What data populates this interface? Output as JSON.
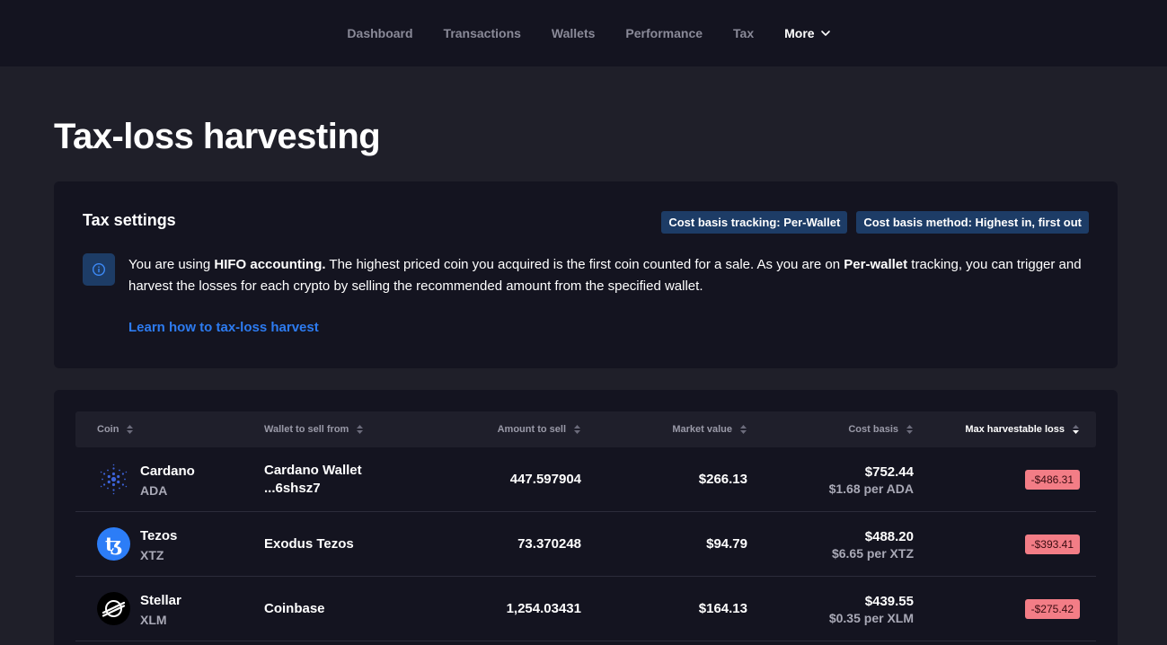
{
  "nav": {
    "items": [
      "Dashboard",
      "Transactions",
      "Wallets",
      "Performance",
      "Tax"
    ],
    "more_label": "More"
  },
  "page_title": "Tax-loss harvesting",
  "settings": {
    "title": "Tax settings",
    "badge_tracking": "Cost basis tracking: Per-Wallet",
    "badge_method": "Cost basis method: Highest in, first out",
    "info_lead": "You are using ",
    "info_bold1": "HIFO accounting.",
    "info_mid": " The highest priced coin you acquired is the first coin counted for a sale. As you are on ",
    "info_bold2": "Per-wallet",
    "info_tail": " tracking, you can trigger and harvest the losses for each crypto by selling the recommended amount from the specified wallet.",
    "learn_link": "Learn how to tax-loss harvest"
  },
  "table": {
    "headers": {
      "coin": "Coin",
      "wallet": "Wallet to sell from",
      "amount": "Amount to sell",
      "market": "Market value",
      "cost": "Cost basis",
      "loss": "Max harvestable loss"
    },
    "rows": [
      {
        "icon": "cardano-icon",
        "name": "Cardano",
        "ticker": "ADA",
        "wallet_line1": "Cardano Wallet",
        "wallet_line2": "...6shsz7",
        "amount": "447.597904",
        "market_value": "$266.13",
        "cost_basis": "$752.44",
        "cost_per": "$1.68 per ADA",
        "loss": "-$486.31"
      },
      {
        "icon": "tezos-icon",
        "name": "Tezos",
        "ticker": "XTZ",
        "wallet_line1": "Exodus Tezos",
        "wallet_line2": "",
        "amount": "73.370248",
        "market_value": "$94.79",
        "cost_basis": "$488.20",
        "cost_per": "$6.65 per XTZ",
        "loss": "-$393.41"
      },
      {
        "icon": "stellar-icon",
        "name": "Stellar",
        "ticker": "XLM",
        "wallet_line1": "Coinbase",
        "wallet_line2": "",
        "amount": "1,254.03431",
        "market_value": "$164.13",
        "cost_basis": "$439.55",
        "cost_per": "$0.35 per XLM",
        "loss": "-$275.42"
      }
    ]
  },
  "colors": {
    "background": "#1f1f29",
    "card": "#141420",
    "badge": "#1d3c66",
    "link": "#2d7bf0",
    "loss_badge": "#f37d86"
  }
}
